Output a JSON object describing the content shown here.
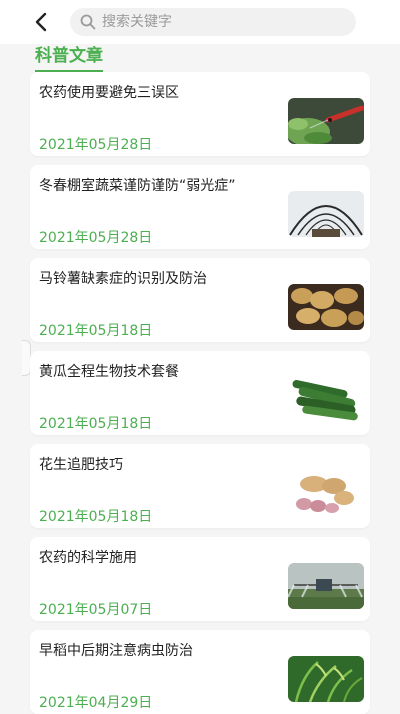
{
  "search": {
    "placeholder": "搜索关键字"
  },
  "section": {
    "title": "科普文章"
  },
  "articles": [
    {
      "title": "农药使用要避免三误区",
      "date": "2021年05月28日",
      "image": "spraying-leaves"
    },
    {
      "title": "冬春棚室蔬菜谨防谨防“弱光症”",
      "date": "2021年05月28日",
      "image": "greenhouse-tunnel"
    },
    {
      "title": "马铃薯缺素症的识别及防治",
      "date": "2021年05月18日",
      "image": "potatoes"
    },
    {
      "title": "黄瓜全程生物技术套餐",
      "date": "2021年05月18日",
      "image": "cucumbers"
    },
    {
      "title": "花生追肥技巧",
      "date": "2021年05月18日",
      "image": "peanuts"
    },
    {
      "title": "农药的科学施用",
      "date": "2021年05月07日",
      "image": "field-spraying"
    },
    {
      "title": "早稻中后期注意病虫防治",
      "date": "2021年04月29日",
      "image": "rice-plants"
    }
  ],
  "colors": {
    "accent": "#4caf50",
    "title_text": "#222222",
    "background": "#f4f5f4"
  }
}
